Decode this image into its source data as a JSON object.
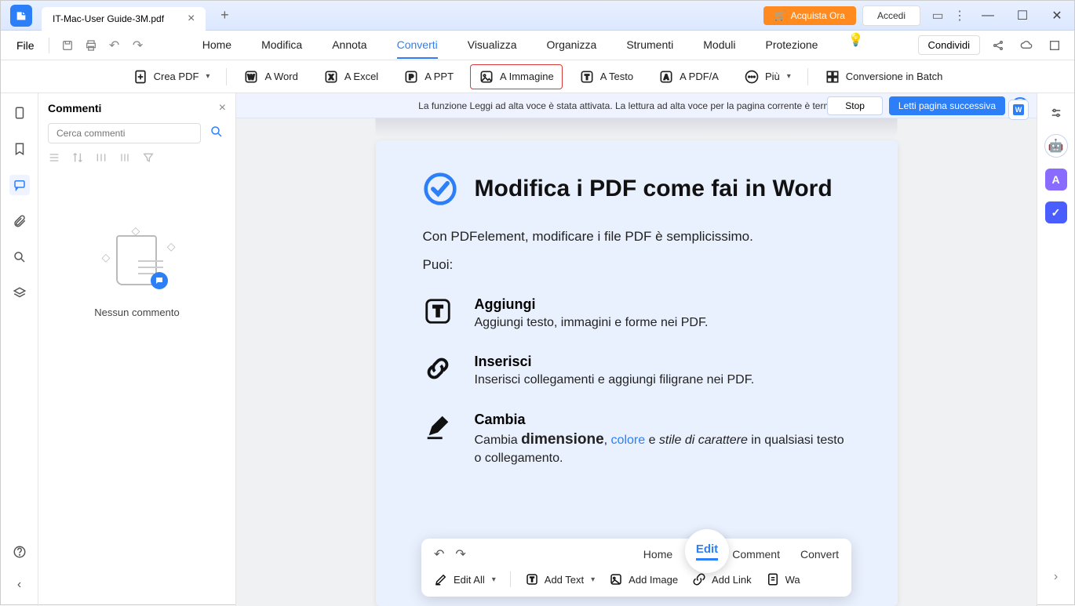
{
  "titlebar": {
    "tab_title": "IT-Mac-User Guide-3M.pdf",
    "buy_label": "Acquista Ora",
    "login_label": "Accedi"
  },
  "menubar": {
    "file_label": "File",
    "tabs": [
      "Home",
      "Modifica",
      "Annota",
      "Converti",
      "Visualizza",
      "Organizza",
      "Strumenti",
      "Moduli",
      "Protezione"
    ],
    "active_index": 3,
    "share_label": "Condividi"
  },
  "toolbar": {
    "create_pdf": "Crea PDF",
    "to_word": "A Word",
    "to_excel": "A Excel",
    "to_ppt": "A PPT",
    "to_image": "A Immagine",
    "to_text": "A Testo",
    "to_pdfa": "A PDF/A",
    "more": "Più",
    "batch": "Conversione in Batch"
  },
  "comments": {
    "title": "Commenti",
    "search_placeholder": "Cerca commenti",
    "empty_text": "Nessun commento"
  },
  "notice": {
    "text": "La funzione Leggi ad alta voce è stata attivata. La lettura ad alta voce per la pagina corrente è terminata.",
    "stop": "Stop",
    "next": "Letti pagina successiva"
  },
  "document": {
    "heading": "Modifica i PDF come fai in Word",
    "intro1": "Con PDFelement, modificare i file PDF è semplicissimo.",
    "intro2": "Puoi:",
    "feat1_title": "Aggiungi",
    "feat1_desc": "Aggiungi testo, immagini e forme nei PDF.",
    "feat2_title": "Inserisci",
    "feat2_desc": "Inserisci collegamenti e aggiungi filigrane nei PDF.",
    "feat3_title": "Cambia",
    "feat3_pre": "Cambia ",
    "feat3_dim": "dimensione",
    "feat3_color": "colore",
    "feat3_and": " e ",
    "feat3_style": "stile di carattere",
    "feat3_post": "  in qualsiasi testo o collegamento."
  },
  "floating": {
    "tab_home": "Home",
    "tab_edit": "Edit",
    "tab_comment": "Comment",
    "tab_convert": "Convert",
    "edit_all": "Edit All",
    "add_text": "Add Text",
    "add_image": "Add Image",
    "add_link": "Add Link",
    "watermark": "Wa"
  }
}
